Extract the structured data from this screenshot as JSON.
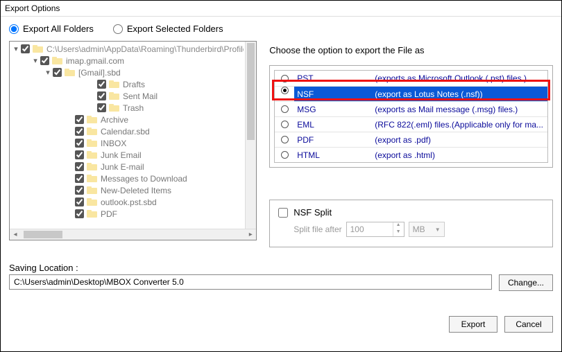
{
  "window": {
    "title": "Export Options"
  },
  "radios": {
    "all": "Export All Folders",
    "selected": "Export Selected Folders"
  },
  "tree": {
    "root": "C:\\Users\\admin\\AppData\\Roaming\\Thunderbird\\Profiles\\j",
    "n1": "imap.gmail.com",
    "n2": "[Gmail].sbd",
    "n3": "Drafts",
    "n4": "Sent Mail",
    "n5": "Trash",
    "n6": "Archive",
    "n7": "Calendar.sbd",
    "n8": "INBOX",
    "n9": "Junk Email",
    "n10": "Junk E-mail",
    "n11": "Messages to Download",
    "n12": "New-Deleted Items",
    "n13": "outlook.pst.sbd",
    "n14": "PDF"
  },
  "right": {
    "label": "Choose the option to export the File as",
    "fmt0": {
      "name": "PST",
      "desc": "(exports as Microsoft Outlook (.pst) files.)"
    },
    "fmt1": {
      "name": "NSF",
      "desc": "(export as Lotus Notes (.nsf))"
    },
    "fmt2": {
      "name": "MSG",
      "desc": "(exports as Mail message (.msg) files.)"
    },
    "fmt3": {
      "name": "EML",
      "desc": "(RFC 822(.eml) files.(Applicable only for ma..."
    },
    "fmt4": {
      "name": "PDF",
      "desc": "(export as .pdf)"
    },
    "fmt5": {
      "name": "HTML",
      "desc": "(export as .html)"
    }
  },
  "split": {
    "label": "NSF Split",
    "after": "Split file after",
    "value": "100",
    "unit": "MB"
  },
  "save": {
    "label": "Saving Location :",
    "path": "C:\\Users\\admin\\Desktop\\MBOX Converter 5.0"
  },
  "buttons": {
    "change": "Change...",
    "export": "Export",
    "cancel": "Cancel"
  }
}
